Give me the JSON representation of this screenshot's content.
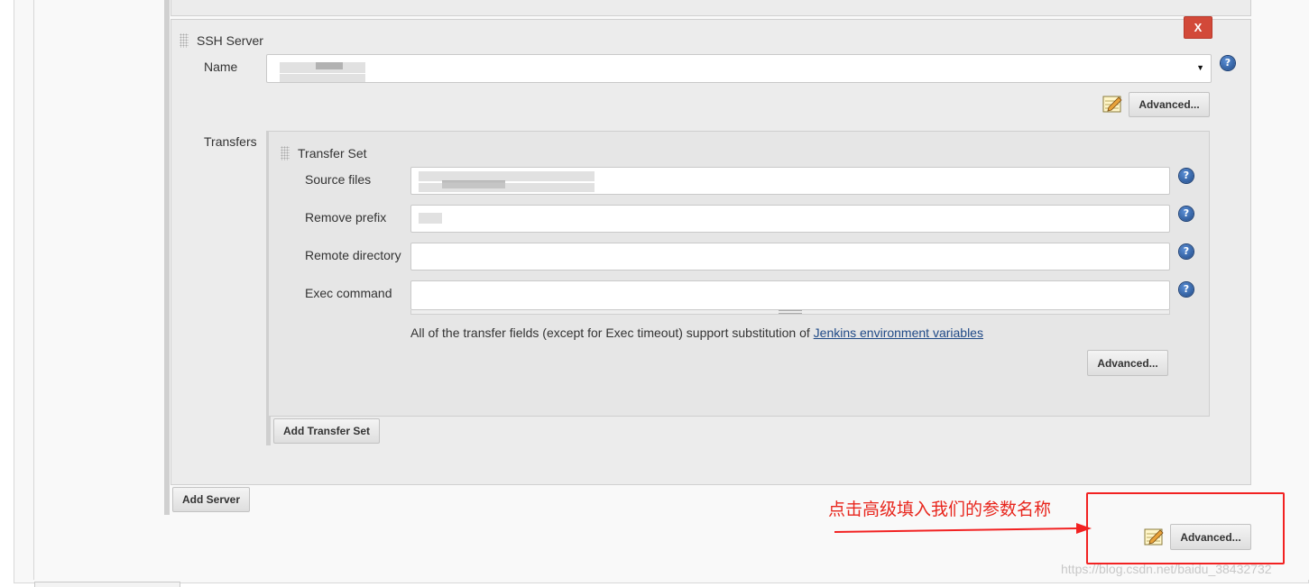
{
  "ssh_server": {
    "heading": "SSH Server",
    "delete_label": "X",
    "name_label": "Name",
    "name_value": "",
    "advanced_label": "Advanced..."
  },
  "transfers": {
    "label": "Transfers",
    "transfer_set": {
      "heading": "Transfer Set",
      "source_files_label": "Source files",
      "source_files_value": "",
      "remove_prefix_label": "Remove prefix",
      "remove_prefix_value": "",
      "remote_directory_label": "Remote directory",
      "remote_directory_value": "",
      "exec_command_label": "Exec command",
      "exec_command_value": "",
      "note_text": "All of the transfer fields (except for Exec timeout) support substitution of ",
      "note_link": "Jenkins environment variables",
      "advanced_label": "Advanced..."
    },
    "add_transfer_set_label": "Add Transfer Set"
  },
  "add_server_label": "Add Server",
  "publisher_advanced_label": "Advanced...",
  "annotation": {
    "text": "点击高级填入我们的参数名称",
    "color": "#e8261d"
  },
  "watermark": "https://blog.csdn.net/baidu_38432732",
  "icons": {
    "help": "help-icon",
    "notepad": "notepad-icon",
    "drag": "drag-handle-icon",
    "dropdown": "chevron-down-icon"
  },
  "colors": {
    "delete_button": "#d24939",
    "link": "#204a87",
    "annotation_box": "#f22222"
  }
}
